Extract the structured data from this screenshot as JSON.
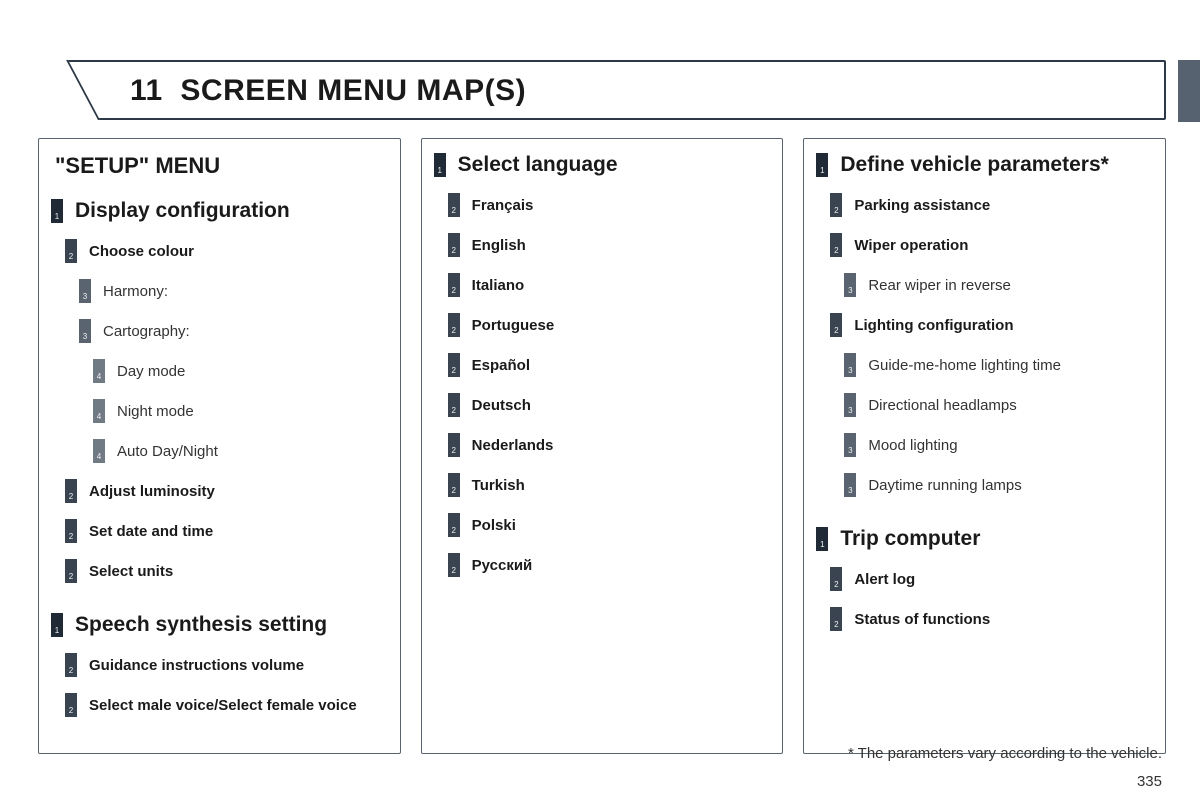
{
  "header": {
    "chapter_number": "11",
    "title": "SCREEN MENU MAP(S)"
  },
  "col1": {
    "panel_title": "\"SETUP\" MENU",
    "items": [
      {
        "level": 1,
        "num": "1",
        "label": "Display configuration"
      },
      {
        "level": 2,
        "num": "2",
        "label": "Choose colour"
      },
      {
        "level": 3,
        "num": "3",
        "label": "Harmony:"
      },
      {
        "level": 3,
        "num": "3",
        "label": "Cartography:"
      },
      {
        "level": 4,
        "num": "4",
        "label": "Day mode"
      },
      {
        "level": 4,
        "num": "4",
        "label": "Night mode"
      },
      {
        "level": 4,
        "num": "4",
        "label": "Auto Day/Night"
      },
      {
        "level": 2,
        "num": "2",
        "label": "Adjust luminosity"
      },
      {
        "level": 2,
        "num": "2",
        "label": "Set date and time"
      },
      {
        "level": 2,
        "num": "2",
        "label": "Select units"
      },
      {
        "level": 1,
        "num": "1",
        "label": "Speech synthesis setting"
      },
      {
        "level": 2,
        "num": "2",
        "label": "Guidance instructions volume"
      },
      {
        "level": 2,
        "num": "2",
        "label": "Select male voice/Select female voice"
      }
    ]
  },
  "col2": {
    "items": [
      {
        "level": 1,
        "num": "1",
        "label": "Select language"
      },
      {
        "level": 2,
        "num": "2",
        "label": "Français"
      },
      {
        "level": 2,
        "num": "2",
        "label": "English"
      },
      {
        "level": 2,
        "num": "2",
        "label": "Italiano"
      },
      {
        "level": 2,
        "num": "2",
        "label": "Portuguese"
      },
      {
        "level": 2,
        "num": "2",
        "label": "Español"
      },
      {
        "level": 2,
        "num": "2",
        "label": "Deutsch"
      },
      {
        "level": 2,
        "num": "2",
        "label": "Nederlands"
      },
      {
        "level": 2,
        "num": "2",
        "label": "Turkish"
      },
      {
        "level": 2,
        "num": "2",
        "label": "Polski"
      },
      {
        "level": 2,
        "num": "2",
        "label": "Русский"
      }
    ]
  },
  "col3": {
    "items": [
      {
        "level": 1,
        "num": "1",
        "label": "Define vehicle parameters*"
      },
      {
        "level": 2,
        "num": "2",
        "label": "Parking assistance"
      },
      {
        "level": 2,
        "num": "2",
        "label": "Wiper operation"
      },
      {
        "level": 3,
        "num": "3",
        "label": "Rear wiper in reverse"
      },
      {
        "level": 2,
        "num": "2",
        "label": "Lighting configuration"
      },
      {
        "level": 3,
        "num": "3",
        "label": "Guide-me-home lighting time"
      },
      {
        "level": 3,
        "num": "3",
        "label": "Directional headlamps"
      },
      {
        "level": 3,
        "num": "3",
        "label": "Mood lighting"
      },
      {
        "level": 3,
        "num": "3",
        "label": "Daytime running lamps"
      },
      {
        "level": 1,
        "num": "1",
        "label": "Trip computer"
      },
      {
        "level": 2,
        "num": "2",
        "label": "Alert log"
      },
      {
        "level": 2,
        "num": "2",
        "label": "Status of functions"
      }
    ]
  },
  "footnote": "* The parameters vary according to the vehicle.",
  "page_number": "335"
}
